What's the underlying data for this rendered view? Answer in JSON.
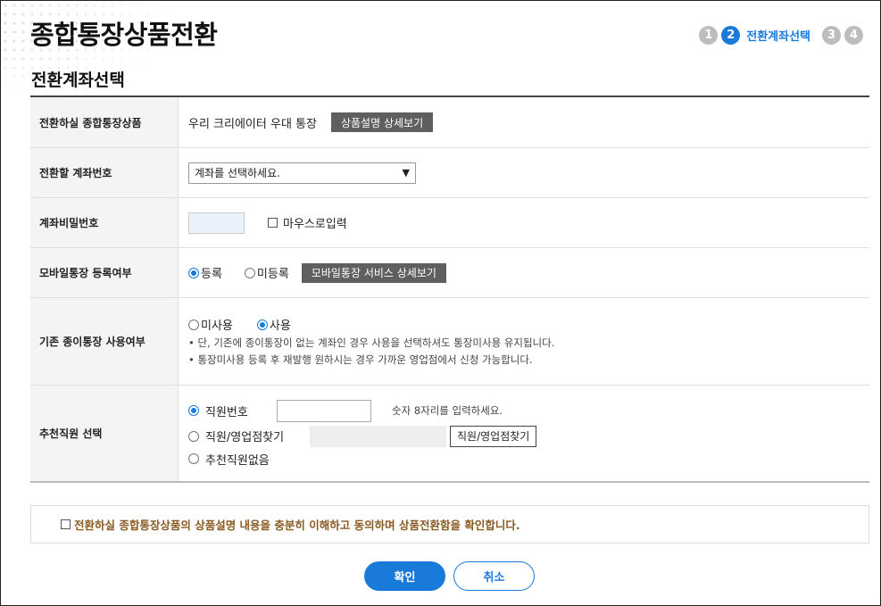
{
  "page": {
    "title": "종합통장상품전환",
    "subtitle": "전환계좌선택",
    "steps": [
      {
        "num": "1",
        "active": false,
        "label": ""
      },
      {
        "num": "2",
        "active": true,
        "label": "전환계좌선택"
      },
      {
        "num": "3",
        "active": false,
        "label": ""
      },
      {
        "num": "4",
        "active": false,
        "label": ""
      }
    ]
  },
  "form": {
    "product": {
      "label": "전환하실 종합통장상품",
      "value": "우리 크리에이터 우대 통장",
      "detail_button": "상품설명 상세보기"
    },
    "account": {
      "label": "전환할 계좌번호",
      "selected": "계좌를 선택하세요."
    },
    "password": {
      "label": "계좌비밀번호",
      "mouse_input_label": "마우스로입력"
    },
    "mobile": {
      "label": "모바일통장 등록여부",
      "option_register": "등록",
      "option_unregister": "미등록",
      "detail_button": "모바일통장 서비스 상세보기"
    },
    "paper": {
      "label": "기존 종이통장 사용여부",
      "option_unused": "미사용",
      "option_used": "사용",
      "notes": [
        "• 단, 기존에 종이통장이 없는 계좌인 경우 사용을 선택하셔도 통장미사용 유지됩니다.",
        "• 통장미사용 등록 후 재발행 원하시는 경우 가까운 영업점에서 신청 가능합니다."
      ]
    },
    "recommender": {
      "label": "추천직원 선택",
      "option_employee_no": "직원번호",
      "hint": "숫자 8자리를 입력하세요.",
      "option_find": "직원/영업점찾기",
      "find_button": "직원/영업점찾기",
      "option_none": "추천직원없음"
    }
  },
  "agreement": {
    "text": "전환하실 종합통장상품의 상품설명 내용을 충분히 이해하고 동의하며 상품전환함을 확인합니다."
  },
  "buttons": {
    "confirm": "확인",
    "cancel": "취소"
  },
  "colors": {
    "accent": "#1a7ad9",
    "agree_text": "#8a5a22",
    "dark_button": "#5f5f5f"
  }
}
